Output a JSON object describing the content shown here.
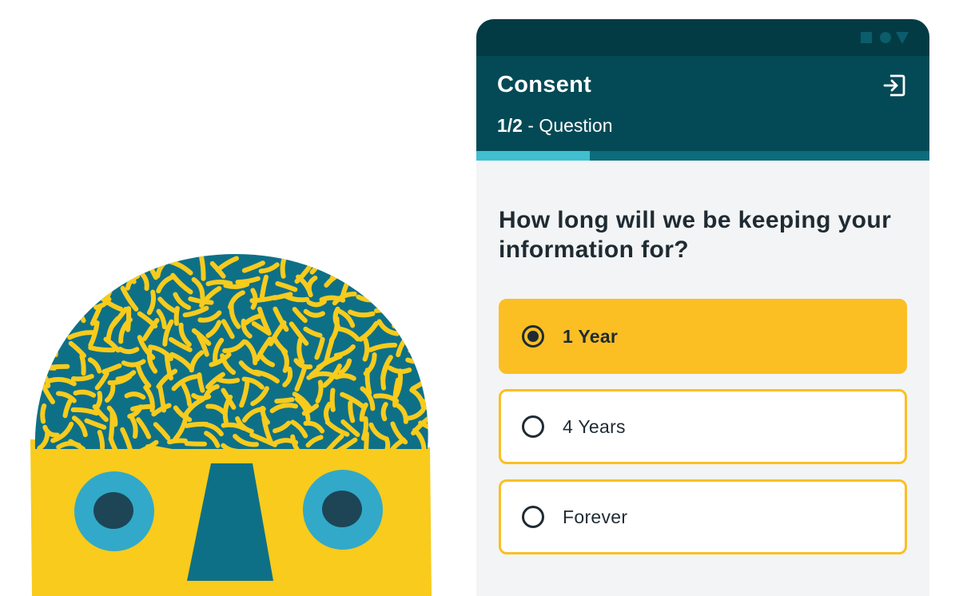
{
  "colors": {
    "status_bar": "#033b45",
    "header": "#044a56",
    "accent": "#fbbf24",
    "progress_track": "#0c6c7c",
    "progress_fill": "#3fbfcf",
    "text_dark": "#1f2b33",
    "illustration_teal": "#0e7087",
    "illustration_yellow": "#f8cb1c",
    "illustration_eye": "#32a9c9"
  },
  "header": {
    "title": "Consent",
    "step": "1/2",
    "step_suffix": " - Question",
    "exit_icon": "exit-icon"
  },
  "progress": {
    "fraction": 0.25
  },
  "question": {
    "text": "How long will we be keeping your information for?"
  },
  "options": [
    {
      "label": "1 Year",
      "selected": true
    },
    {
      "label": "4 Years",
      "selected": false
    },
    {
      "label": "Forever",
      "selected": false
    }
  ]
}
